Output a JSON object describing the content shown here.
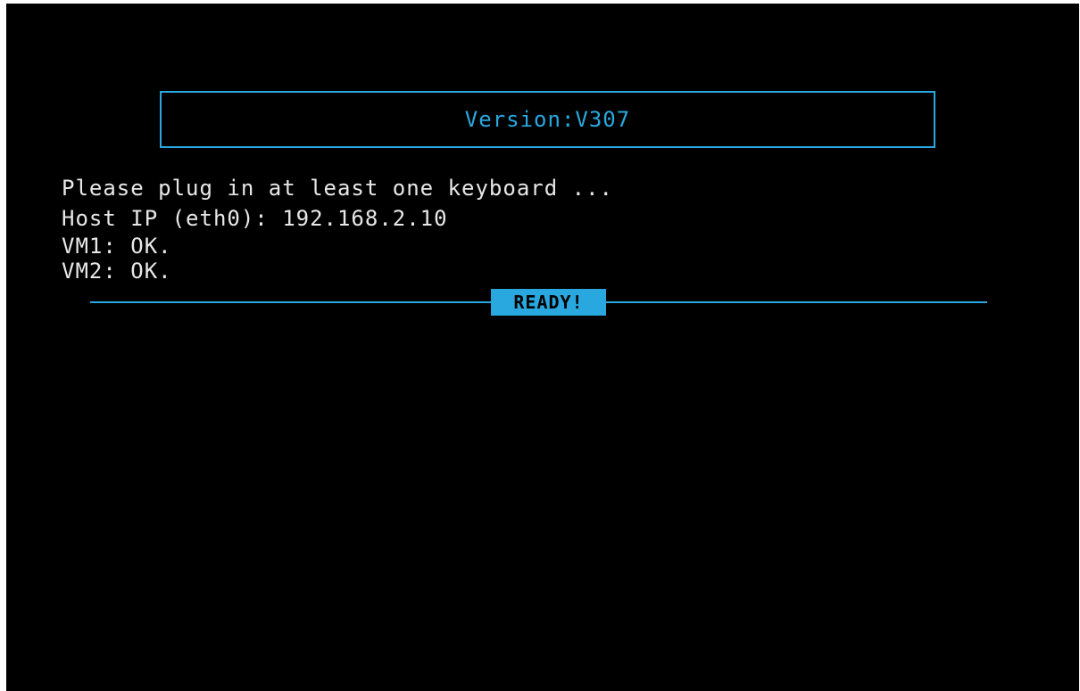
{
  "header": {
    "version_label": "Version:V307"
  },
  "console": {
    "lines": [
      "Please plug in at least one keyboard ...",
      "Host IP (eth0): 192.168.2.10",
      "VM1: OK.",
      "VM2: OK."
    ]
  },
  "status": {
    "badge": "READY!"
  },
  "colors": {
    "accent": "#29a8e0",
    "text": "#e8e8e8",
    "background": "#000000"
  }
}
